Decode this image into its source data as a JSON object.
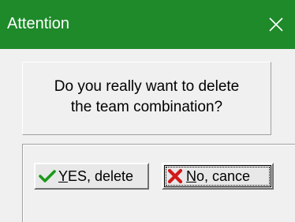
{
  "window": {
    "title": "Attention",
    "title_bar_color": "#1e8a2a",
    "close_icon": "close-icon"
  },
  "message": {
    "line1": "Do you really want to delete",
    "line2": "the team combination?"
  },
  "buttons": {
    "yes": {
      "mnemonic": "Y",
      "rest": "ES, delete",
      "icon": "checkmark-icon",
      "icon_color": "#1a9a1a"
    },
    "no": {
      "mnemonic": "N",
      "rest": "o, cance",
      "icon": "cross-icon",
      "icon_color": "#d11a1a",
      "focused": true
    }
  }
}
